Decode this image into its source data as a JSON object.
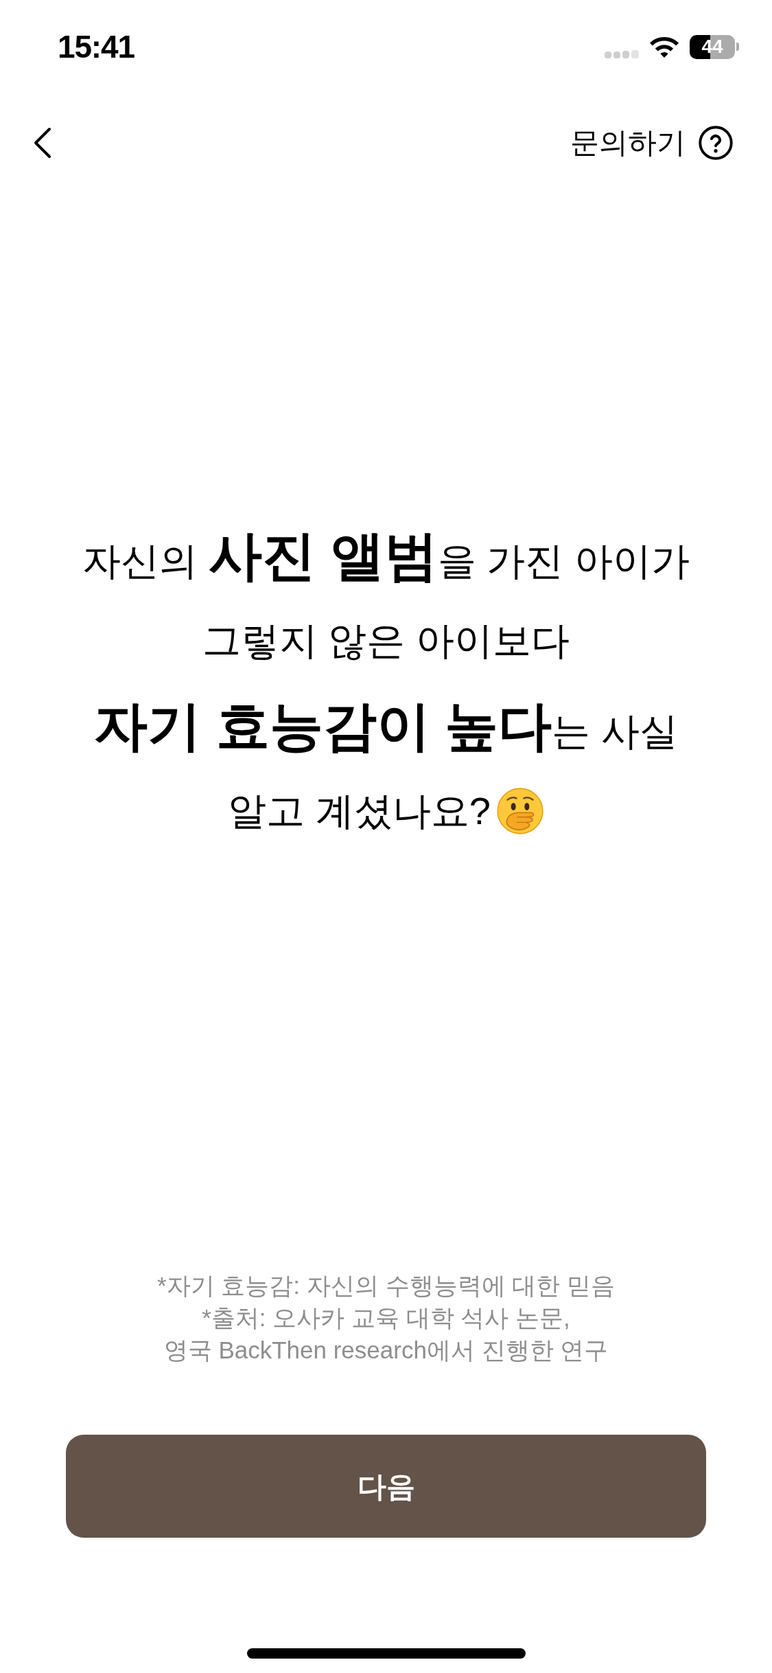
{
  "status_bar": {
    "time": "15:41",
    "battery": "44"
  },
  "nav": {
    "help_label": "문의하기"
  },
  "headline": {
    "lines": [
      "자신의 **사진 앨범**을 가진 아이가",
      "그렇지 않은 아이보다",
      "**자기 효능감이 높다**는 사실",
      "알고 계셨나요?"
    ]
  },
  "footnotes": [
    "*자기 효능감: 자신의 수행능력에 대한 믿음",
    "*출처: 오사카 교육 대학 석사 논문,",
    "영국 BackThen research에서 진행한 연구"
  ],
  "button": {
    "label": "다음"
  }
}
